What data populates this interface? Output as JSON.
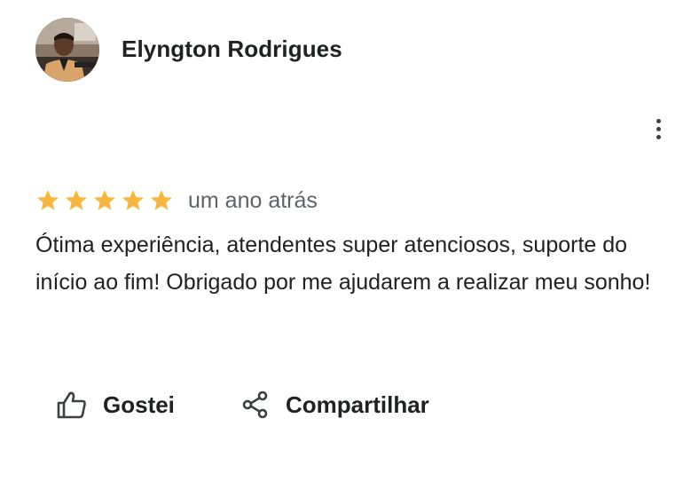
{
  "reviewer": {
    "name": "Elyngton Rodrigues"
  },
  "review": {
    "rating": 5,
    "rating_max": 5,
    "date": "um ano atrás",
    "text": "Ótima experiência, atendentes super atenciosos, suporte do início ao fim! Obrigado por me ajudarem a realizar meu sonho!"
  },
  "actions": {
    "like_label": "Gostei",
    "share_label": "Compartilhar"
  },
  "colors": {
    "star": "#F5B83D",
    "text": "#202124",
    "secondary_text": "#5F6368",
    "icon": "#3C4043"
  },
  "icons": {
    "more": "more-vertical-icon",
    "like": "thumbs-up-icon",
    "share": "share-icon",
    "star": "star-icon"
  }
}
